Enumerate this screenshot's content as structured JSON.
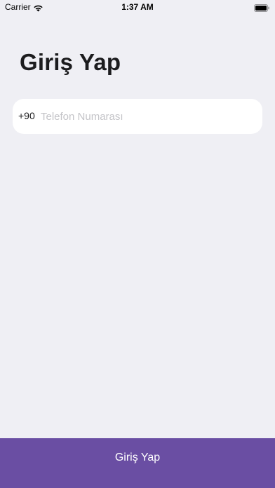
{
  "status_bar": {
    "carrier": "Carrier",
    "time": "1:37 AM",
    "wifi_icon": "wifi-icon",
    "battery_icon": "battery-icon"
  },
  "page": {
    "title": "Giriş Yap"
  },
  "phone_field": {
    "country_code": "+90",
    "value": "",
    "placeholder": "Telefon Numarası"
  },
  "login_button": {
    "label": "Giriş Yap",
    "color": "#6a4ea3"
  },
  "colors": {
    "background": "#efeff4",
    "accent": "#6a4ea3",
    "field_background": "#ffffff"
  }
}
